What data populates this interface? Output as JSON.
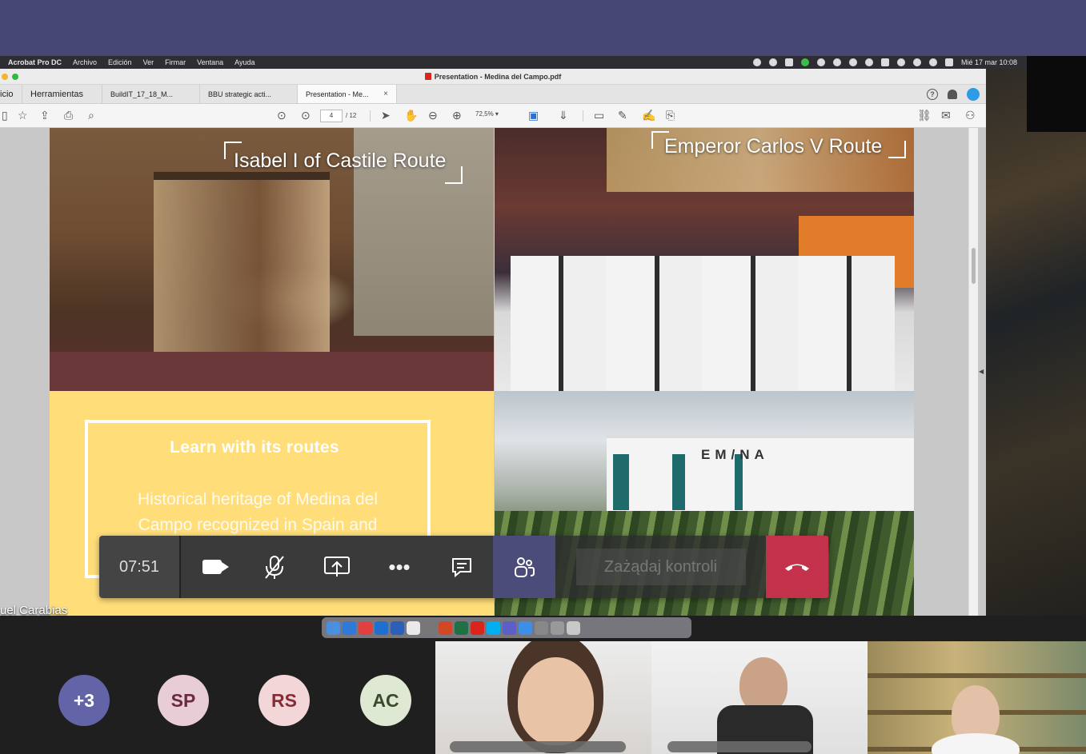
{
  "menubar": {
    "app": "Acrobat Pro DC",
    "items": [
      "Archivo",
      "Edición",
      "Ver",
      "Firmar",
      "Ventana",
      "Ayuda"
    ],
    "clock": "Mié 17 mar  10:08"
  },
  "window": {
    "title": "Presentation - Medina del Campo.pdf"
  },
  "tabs": [
    {
      "label": "icio"
    },
    {
      "label": "Herramientas"
    },
    {
      "label": "BuildIT_17_18_M..."
    },
    {
      "label": "BBU strategic acti..."
    },
    {
      "label": "Presentation - Me...",
      "close": "×"
    }
  ],
  "toolbar": {
    "page_current": "4",
    "page_total": "/ 12",
    "zoom": "72,5%"
  },
  "slide": {
    "route1": "Isabel I of Castile Route",
    "route2": "Emperor Carlos V Route",
    "heading": "Learn with its routes",
    "body": "Historical heritage of Medina del Campo recognized in Spain and",
    "building_sign": "EM/NA"
  },
  "presenter_name": "uel Carabias",
  "call_controls": {
    "timer": "07:51",
    "request_control": "Zażądaj kontroli"
  },
  "participants": [
    {
      "initials": "+3",
      "bg": "#6264a7",
      "fg": "#ffffff"
    },
    {
      "initials": "SP",
      "bg": "#e8cdd6",
      "fg": "#6b2a3e"
    },
    {
      "initials": "RS",
      "bg": "#f3d6d8",
      "fg": "#8a2a36"
    },
    {
      "initials": "AC",
      "bg": "#dfe8d2",
      "fg": "#3b4a2a"
    }
  ],
  "colors": {
    "teams_purple": "#464775",
    "hangup": "#c4314b",
    "slide_yellow": "#ffde7a"
  }
}
